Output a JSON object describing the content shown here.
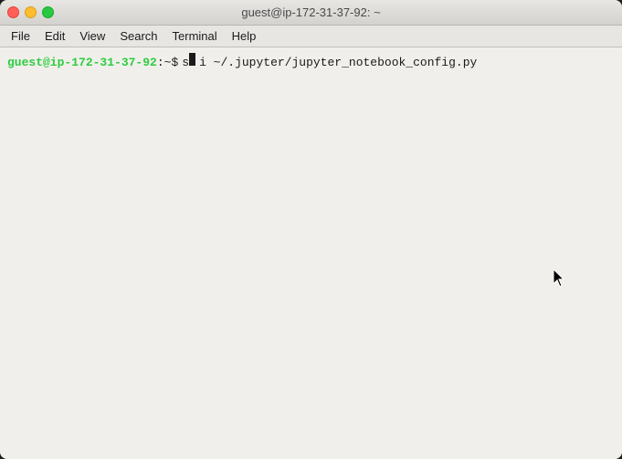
{
  "window": {
    "title": "guest@ip-172-31-37-92: ~",
    "traffic_lights": {
      "close_label": "close",
      "minimize_label": "minimize",
      "maximize_label": "maximize"
    }
  },
  "menu": {
    "items": [
      {
        "label": "File",
        "id": "file"
      },
      {
        "label": "Edit",
        "id": "edit"
      },
      {
        "label": "View",
        "id": "view"
      },
      {
        "label": "Search",
        "id": "search"
      },
      {
        "label": "Terminal",
        "id": "terminal"
      },
      {
        "label": "Help",
        "id": "help"
      }
    ]
  },
  "terminal": {
    "prompt_host": "guest@ip-172-31-37-92",
    "prompt_separator": ":~",
    "prompt_symbol": "$",
    "command_before_cursor": "s",
    "command_cursor": "v",
    "command_after_cursor": "i ~/.jupyter/jupyter_notebook_config.py"
  }
}
